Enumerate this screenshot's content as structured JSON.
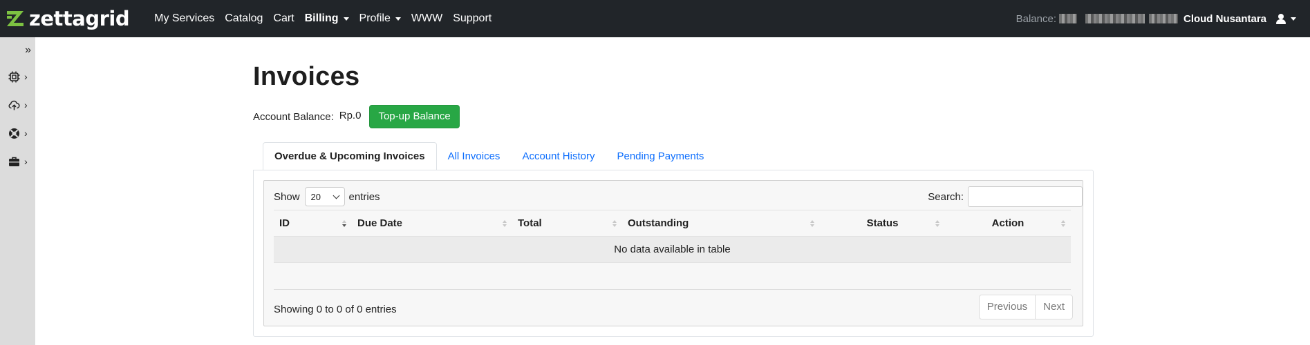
{
  "brand": {
    "name": "zettagrid",
    "color": "#7dc242"
  },
  "nav": {
    "items": [
      {
        "label": "My Services",
        "dropdown": false,
        "active": false
      },
      {
        "label": "Catalog",
        "dropdown": false,
        "active": false
      },
      {
        "label": "Cart",
        "dropdown": false,
        "active": false
      },
      {
        "label": "Billing",
        "dropdown": true,
        "active": true
      },
      {
        "label": "Profile",
        "dropdown": true,
        "active": false
      },
      {
        "label": "WWW",
        "dropdown": false,
        "active": false
      },
      {
        "label": "Support",
        "dropdown": false,
        "active": false
      }
    ],
    "balance_label": "Balance:",
    "company": "Cloud Nusantara",
    "user_icon": "user-icon"
  },
  "sidebar": {
    "toggle_icon": "double-chevron-right-icon",
    "items": [
      {
        "icon": "cpu-icon"
      },
      {
        "icon": "cloud-upload-icon"
      },
      {
        "icon": "lifebuoy-icon"
      },
      {
        "icon": "briefcase-icon"
      }
    ]
  },
  "page": {
    "title": "Invoices",
    "account_balance_label": "Account Balance:",
    "account_balance_value": "Rp.0",
    "topup_label": "Top-up Balance",
    "topup_color": "#28a745"
  },
  "tabs": [
    {
      "label": "Overdue & Upcoming Invoices",
      "active": true
    },
    {
      "label": "All Invoices",
      "active": false
    },
    {
      "label": "Account History",
      "active": false
    },
    {
      "label": "Pending Payments",
      "active": false
    }
  ],
  "table": {
    "show_label": "Show",
    "entries_label": "entries",
    "page_length": "20",
    "search_label": "Search:",
    "search_value": "",
    "columns": [
      "ID",
      "Due Date",
      "Total",
      "Outstanding",
      "Status",
      "Action"
    ],
    "empty_message": "No data available in table",
    "info": "Showing 0 to 0 of 0 entries",
    "prev_label": "Previous",
    "next_label": "Next"
  }
}
